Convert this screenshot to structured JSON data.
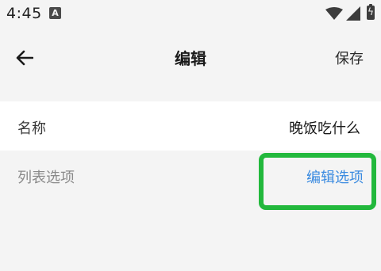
{
  "status_bar": {
    "time": "4:45",
    "app_icon_letter": "A",
    "battery_glyph": "ϟ"
  },
  "toolbar": {
    "title": "编辑",
    "save_label": "保存"
  },
  "fields": {
    "name_label": "名称",
    "name_value": "晚饭吃什么",
    "options_label": "列表选项",
    "options_action": "编辑选项"
  },
  "colors": {
    "accent_link": "#3b8be0",
    "highlight": "#22b83c"
  },
  "icons": [
    "back-arrow-icon",
    "wifi-icon",
    "cellular-signal-icon",
    "battery-icon"
  ]
}
